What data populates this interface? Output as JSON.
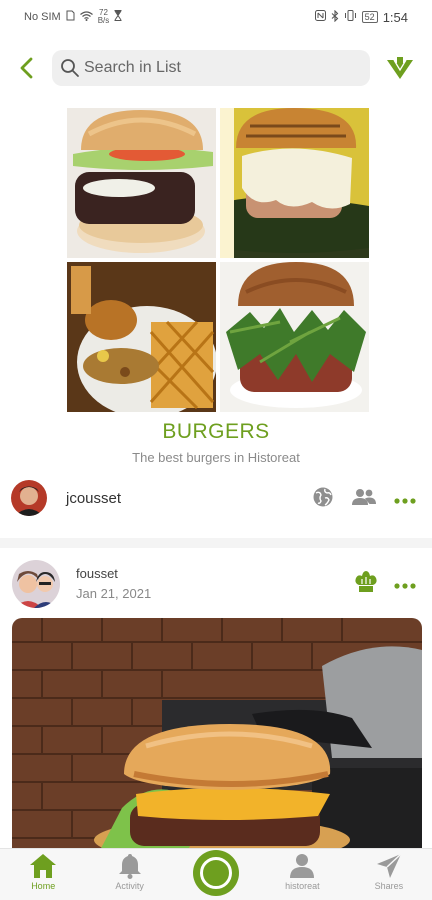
{
  "status_bar": {
    "carrier": "No SIM",
    "net_speed_value": "72",
    "net_speed_unit": "B/s",
    "battery": "52",
    "time": "1:54"
  },
  "search": {
    "placeholder": "Search in List"
  },
  "list": {
    "title": "BURGERS",
    "subtitle": "The best burgers in Historeat"
  },
  "owner": {
    "name": "jcousset"
  },
  "post": {
    "user": "fousset",
    "date": "Jan 21, 2021"
  },
  "nav": {
    "home": "Home",
    "activity": "Activity",
    "historeat": "historeat",
    "shares": "Shares"
  },
  "colors": {
    "brand_green": "#6e9f1f",
    "search_bg": "#efefef",
    "nav_bg": "#f7f7f7"
  }
}
